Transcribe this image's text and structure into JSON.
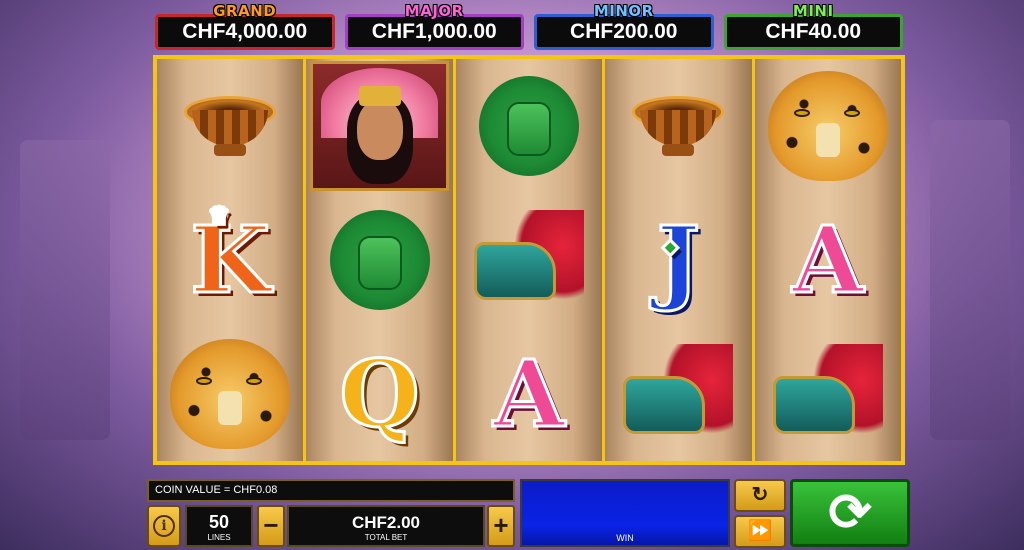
{
  "jackpots": [
    {
      "title": "GRAND",
      "amount": "CHF4,000.00"
    },
    {
      "title": "MAJOR",
      "amount": "CHF1,000.00"
    },
    {
      "title": "MINOR",
      "amount": "CHF200.00"
    },
    {
      "title": "MINI",
      "amount": "CHF40.00"
    }
  ],
  "reels": [
    [
      "bowl",
      "king",
      "jaguar"
    ],
    [
      "princess",
      "mask",
      "queen"
    ],
    [
      "mask",
      "serpent",
      "ace"
    ],
    [
      "bowl",
      "jack",
      "serpent"
    ],
    [
      "jaguar",
      "ace",
      "serpent"
    ]
  ],
  "letters": {
    "king": "K",
    "queen": "Q",
    "jack": "J",
    "ace": "A"
  },
  "controls": {
    "coin_value": "COIN VALUE = CHF0.08",
    "lines_value": "50",
    "lines_label": "LINES",
    "minus_label": "−",
    "plus_label": "+",
    "total_bet_value": "CHF2.00",
    "total_bet_label": "TOTAL BET",
    "win_label": "WIN",
    "autoplay_icon": "refresh-icon",
    "turbo_icon": "fast-forward-icon",
    "spin_icon": "spin-icon",
    "info_icon": "info-icon"
  }
}
